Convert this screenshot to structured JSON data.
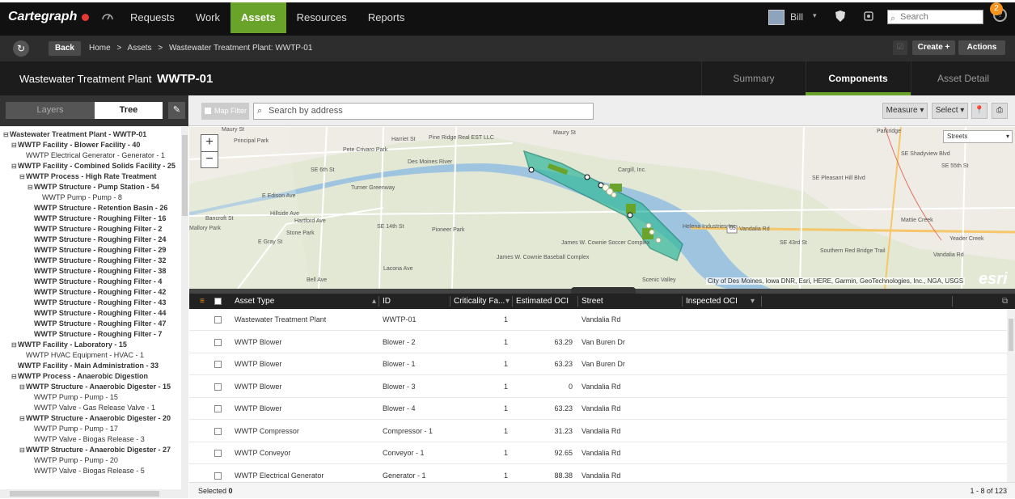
{
  "app": {
    "logo": "Cartegraph"
  },
  "nav": {
    "items": [
      "Requests",
      "Work",
      "Assets",
      "Resources",
      "Reports"
    ],
    "active": "Assets"
  },
  "user": {
    "name": "Bill",
    "notifications": "2",
    "search_placeholder": "Search",
    "help_glyph": "?"
  },
  "toolbar": {
    "back": "Back",
    "create": "Create +",
    "actions": "Actions"
  },
  "breadcrumb": [
    "Home",
    ">",
    "Assets",
    ">",
    "Wastewater Treatment Plant: WWTP-01"
  ],
  "header": {
    "title_prefix": "Wastewater Treatment Plant",
    "title_id": "WWTP-01"
  },
  "tabs": [
    {
      "label": "Summary"
    },
    {
      "label": "Components"
    },
    {
      "label": "Asset Detail"
    }
  ],
  "left_panel": {
    "layers_label": "Layers",
    "tree_label": "Tree"
  },
  "tree": [
    {
      "label": "Wastewater Treatment Plant - WWTP-01",
      "level": 0,
      "bold": true,
      "expander": "⊟"
    },
    {
      "label": "WWTP Facility - Blower Facility - 40",
      "level": 1,
      "bold": true,
      "expander": "⊟"
    },
    {
      "label": "WWTP Electrical Generator - Generator - 1",
      "level": 2,
      "bold": false,
      "expander": ""
    },
    {
      "label": "WWTP Facility - Combined Solids Facility - 25",
      "level": 1,
      "bold": true,
      "expander": "⊟"
    },
    {
      "label": "WWTP Process - High Rate Treatment",
      "level": 2,
      "bold": true,
      "expander": "⊟"
    },
    {
      "label": "WWTP Structure - Pump Station - 54",
      "level": 3,
      "bold": true,
      "expander": "⊟"
    },
    {
      "label": "WWTP Pump - Pump - 8",
      "level": 4,
      "bold": false,
      "expander": ""
    },
    {
      "label": "WWTP Structure - Retention Basin - 26",
      "level": 3,
      "bold": true,
      "expander": ""
    },
    {
      "label": "WWTP Structure - Roughing Filter - 16",
      "level": 3,
      "bold": true,
      "expander": ""
    },
    {
      "label": "WWTP Structure - Roughing Filter - 2",
      "level": 3,
      "bold": true,
      "expander": ""
    },
    {
      "label": "WWTP Structure - Roughing Filter - 24",
      "level": 3,
      "bold": true,
      "expander": ""
    },
    {
      "label": "WWTP Structure - Roughing Filter - 29",
      "level": 3,
      "bold": true,
      "expander": ""
    },
    {
      "label": "WWTP Structure - Roughing Filter - 32",
      "level": 3,
      "bold": true,
      "expander": ""
    },
    {
      "label": "WWTP Structure - Roughing Filter - 38",
      "level": 3,
      "bold": true,
      "expander": ""
    },
    {
      "label": "WWTP Structure - Roughing Filter - 4",
      "level": 3,
      "bold": true,
      "expander": ""
    },
    {
      "label": "WWTP Structure - Roughing Filter - 42",
      "level": 3,
      "bold": true,
      "expander": ""
    },
    {
      "label": "WWTP Structure - Roughing Filter - 43",
      "level": 3,
      "bold": true,
      "expander": ""
    },
    {
      "label": "WWTP Structure - Roughing Filter - 44",
      "level": 3,
      "bold": true,
      "expander": ""
    },
    {
      "label": "WWTP Structure - Roughing Filter - 47",
      "level": 3,
      "bold": true,
      "expander": ""
    },
    {
      "label": "WWTP Structure - Roughing Filter - 7",
      "level": 3,
      "bold": true,
      "expander": ""
    },
    {
      "label": "WWTP Facility - Laboratory - 15",
      "level": 1,
      "bold": true,
      "expander": "⊟"
    },
    {
      "label": "WWTP HVAC Equipment - HVAC - 1",
      "level": 2,
      "bold": false,
      "expander": ""
    },
    {
      "label": "WWTP Facility - Main Administration - 33",
      "level": 1,
      "bold": true,
      "expander": ""
    },
    {
      "label": "WWTP Process - Anaerobic Digestion",
      "level": 1,
      "bold": true,
      "expander": "⊟"
    },
    {
      "label": "WWTP Structure - Anaerobic Digester - 15",
      "level": 2,
      "bold": true,
      "expander": "⊟"
    },
    {
      "label": "WWTP Pump - Pump - 15",
      "level": 3,
      "bold": false,
      "expander": ""
    },
    {
      "label": "WWTP Valve - Gas Release Valve - 1",
      "level": 3,
      "bold": false,
      "expander": ""
    },
    {
      "label": "WWTP Structure - Anaerobic Digester - 20",
      "level": 2,
      "bold": true,
      "expander": "⊟"
    },
    {
      "label": "WWTP Pump - Pump - 17",
      "level": 3,
      "bold": false,
      "expander": ""
    },
    {
      "label": "WWTP Valve - Biogas Release - 3",
      "level": 3,
      "bold": false,
      "expander": ""
    },
    {
      "label": "WWTP Structure - Anaerobic Digester - 27",
      "level": 2,
      "bold": true,
      "expander": "⊟"
    },
    {
      "label": "WWTP Pump - Pump - 20",
      "level": 3,
      "bold": false,
      "expander": ""
    },
    {
      "label": "WWTP Valve - Biogas Release - 5",
      "level": 3,
      "bold": false,
      "expander": ""
    }
  ],
  "map_toolbar": {
    "map_filter": "Map Filter",
    "search_placeholder": "Search by address",
    "measure": "Measure",
    "select": "Select"
  },
  "map": {
    "basemap": "Streets",
    "attribution": "City of Des Moines, Iowa DNR, Esri, HERE, Garmin, GeoTechnologies, Inc., NGA, USGS",
    "esri_logo": "esri",
    "labels": [
      "Maury St",
      "Harriet St",
      "Des Moines River",
      "E Edison Ave",
      "Hillside Ave",
      "Hartford Ave",
      "Bancroft St",
      "E Gray St",
      "Lacona Ave",
      "Bell Ave",
      "Vandalia Rd",
      "Pioneer Park",
      "Stone Park",
      "James W. Cownie Soccer Complex",
      "James W. Cownie Baseball Complex",
      "Helena Industries Inc",
      "Cargill, Inc.",
      "Pine Ridge Real EST LLC",
      "Principal Park",
      "Pete Crivaro Park",
      "Turner Greenway",
      "Parkridge",
      "SE Pleasant Hill Blvd",
      "Vandalia Rd",
      "Yeader Creek",
      "SE 14th St",
      "SE 6th St",
      "Maury St",
      "Scenic Valley",
      "Mallory Park",
      "Southern Red Bridge Trail",
      "SE 43rd St",
      "Mattie Creek",
      "SE Shadyview Blvd",
      "SE 55th St"
    ],
    "highway_shield": "65"
  },
  "grid": {
    "columns": [
      "Asset Type",
      "ID",
      "Criticality Fa...",
      "Estimated OCI",
      "Street",
      "Inspected OCI"
    ],
    "rows": [
      {
        "asset_type": "Wastewater Treatment Plant",
        "id": "WWTP-01",
        "criticality": "1",
        "oci": "",
        "street": "Vandalia Rd"
      },
      {
        "asset_type": "WWTP Blower",
        "id": "Blower - 2",
        "criticality": "1",
        "oci": "63.29",
        "street": "Van Buren Dr"
      },
      {
        "asset_type": "WWTP Blower",
        "id": "Blower - 1",
        "criticality": "1",
        "oci": "63.23",
        "street": "Van Buren Dr"
      },
      {
        "asset_type": "WWTP Blower",
        "id": "Blower - 3",
        "criticality": "1",
        "oci": "0",
        "street": "Vandalia Rd"
      },
      {
        "asset_type": "WWTP Blower",
        "id": "Blower - 4",
        "criticality": "1",
        "oci": "63.23",
        "street": "Vandalia Rd"
      },
      {
        "asset_type": "WWTP Compressor",
        "id": "Compressor - 1",
        "criticality": "1",
        "oci": "31.23",
        "street": "Vandalia Rd"
      },
      {
        "asset_type": "WWTP Conveyor",
        "id": "Conveyor - 1",
        "criticality": "1",
        "oci": "92.65",
        "street": "Vandalia Rd"
      },
      {
        "asset_type": "WWTP Electrical Generator",
        "id": "Generator - 1",
        "criticality": "1",
        "oci": "88.38",
        "street": "Vandalia Rd"
      }
    ]
  },
  "footer": {
    "selected_label": "Selected",
    "selected_count": "0",
    "paging": "1 - 8 of 123"
  },
  "colors": {
    "accent": "#6aa32a",
    "notification": "#f7941d",
    "dark_bar": "#111111",
    "river": "#9ec4e0",
    "asset_polygon": "#3dbba0"
  }
}
